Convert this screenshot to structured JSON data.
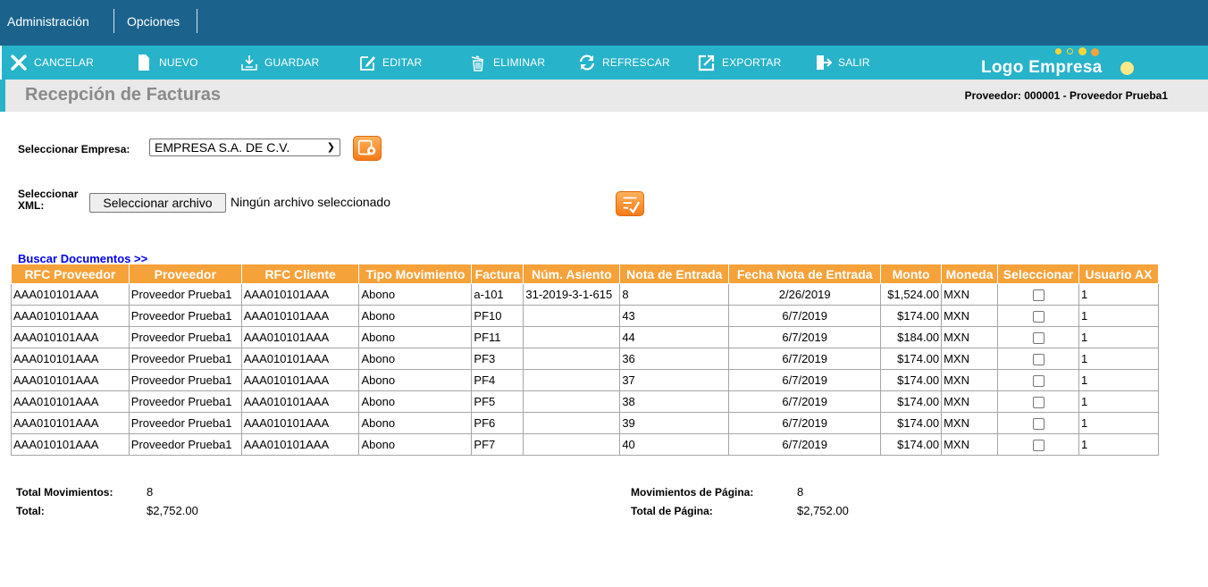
{
  "menu": {
    "items": [
      "Administración",
      "Opciones"
    ]
  },
  "toolbar": {
    "buttons": [
      {
        "label": "CANCELAR",
        "icon": "x-icon"
      },
      {
        "label": "NUEVO",
        "icon": "document-icon"
      },
      {
        "label": "GUARDAR",
        "icon": "save-icon"
      },
      {
        "label": "EDITAR",
        "icon": "edit-icon"
      },
      {
        "label": "ELIMINAR",
        "icon": "trash-icon"
      },
      {
        "label": "REFRESCAR",
        "icon": "refresh-icon"
      },
      {
        "label": "EXPORTAR",
        "icon": "export-icon"
      },
      {
        "label": "SALIR",
        "icon": "exit-icon"
      }
    ],
    "logo_text": "Logo Empresa"
  },
  "header": {
    "title": "Recepción de Facturas",
    "provider": "Proveedor: 000001 - Proveedor Prueba1"
  },
  "form": {
    "empresa_label": "Seleccionar Empresa:",
    "empresa_value": "EMPRESA S.A. DE C.V.",
    "xml_label_line1": "Seleccionar",
    "xml_label_line2": "XML:",
    "file_button": "Seleccionar archivo",
    "file_status": "Ningún archivo seleccionado",
    "search_link": "Buscar Documentos >>"
  },
  "table": {
    "columns": [
      "RFC Proveedor",
      "Proveedor",
      "RFC Cliente",
      "Tipo Movimiento",
      "Factura",
      "Núm. Asiento",
      "Nota de Entrada",
      "Fecha Nota de Entrada",
      "Monto",
      "Moneda",
      "Seleccionar",
      "Usuario AX"
    ],
    "rows": [
      [
        "AAA010101AAA",
        "Proveedor Prueba1",
        "AAA010101AAA",
        "Abono",
        "a-101",
        "31-2019-3-1-615",
        "8",
        "2/26/2019",
        "$1,524.00",
        "MXN",
        "",
        "1"
      ],
      [
        "AAA010101AAA",
        "Proveedor Prueba1",
        "AAA010101AAA",
        "Abono",
        "PF10",
        "",
        "43",
        "6/7/2019",
        "$174.00",
        "MXN",
        "",
        "1"
      ],
      [
        "AAA010101AAA",
        "Proveedor Prueba1",
        "AAA010101AAA",
        "Abono",
        "PF11",
        "",
        "44",
        "6/7/2019",
        "$184.00",
        "MXN",
        "",
        "1"
      ],
      [
        "AAA010101AAA",
        "Proveedor Prueba1",
        "AAA010101AAA",
        "Abono",
        "PF3",
        "",
        "36",
        "6/7/2019",
        "$174.00",
        "MXN",
        "",
        "1"
      ],
      [
        "AAA010101AAA",
        "Proveedor Prueba1",
        "AAA010101AAA",
        "Abono",
        "PF4",
        "",
        "37",
        "6/7/2019",
        "$174.00",
        "MXN",
        "",
        "1"
      ],
      [
        "AAA010101AAA",
        "Proveedor Prueba1",
        "AAA010101AAA",
        "Abono",
        "PF5",
        "",
        "38",
        "6/7/2019",
        "$174.00",
        "MXN",
        "",
        "1"
      ],
      [
        "AAA010101AAA",
        "Proveedor Prueba1",
        "AAA010101AAA",
        "Abono",
        "PF6",
        "",
        "39",
        "6/7/2019",
        "$174.00",
        "MXN",
        "",
        "1"
      ],
      [
        "AAA010101AAA",
        "Proveedor Prueba1",
        "AAA010101AAA",
        "Abono",
        "PF7",
        "",
        "40",
        "6/7/2019",
        "$174.00",
        "MXN",
        "",
        "1"
      ]
    ]
  },
  "totals": {
    "movimientos_label": "Total Movimientos:",
    "movimientos_value": "8",
    "total_label": "Total:",
    "total_value": "$2,752.00",
    "mov_pagina_label": "Movimientos de Página:",
    "mov_pagina_value": "8",
    "total_pagina_label": "Total de Página:",
    "total_pagina_value": "$2,752.00"
  },
  "colors": {
    "topbar": "#1b638d",
    "toolbar": "#27b3c9",
    "header_orange": "#f6a23a"
  }
}
